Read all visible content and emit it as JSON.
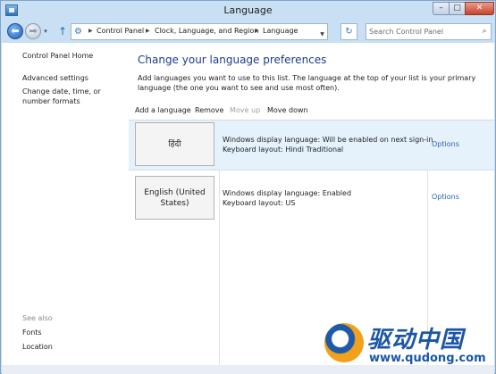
{
  "window": {
    "title": "Language",
    "controls": {
      "minimize": "–",
      "maximize": "□",
      "close": "✕"
    }
  },
  "nav": {
    "back": "⬅",
    "forward": "➡",
    "history": "▾",
    "up": "↑",
    "address": [
      "Control Panel",
      "Clock, Language, and Region",
      "Language"
    ],
    "refresh": "↻",
    "search_placeholder": "Search Control Panel"
  },
  "left_pane": {
    "home": "Control Panel Home",
    "links": [
      "Advanced settings",
      "Change date, time, or number formats"
    ],
    "see_also_heading": "See also",
    "see_also": [
      "Fonts",
      "Location"
    ]
  },
  "main": {
    "title": "Change your language preferences",
    "description": "Add languages you want to use to this list. The language at the top of your list is your primary language (the one you want to see and use most often).",
    "toolbar": {
      "add": "Add a language",
      "remove": "Remove",
      "move_up": "Move up",
      "move_down": "Move down"
    },
    "languages": [
      {
        "name": "हिंदी",
        "display": "Windows display language: Will be enabled on next sign-in",
        "keyboard": "Keyboard layout: Hindi Traditional",
        "options": "Options",
        "selected": true
      },
      {
        "name": "English (United States)",
        "display": "Windows display language: Enabled",
        "keyboard": "Keyboard layout: US",
        "options": "Options",
        "selected": false
      }
    ]
  },
  "watermark": {
    "name": "驱动中国",
    "url": "www.qudong.com"
  },
  "colors": {
    "frame": "#c9dff3",
    "accent_link": "#2b62b8",
    "heading": "#1e3c8c",
    "selected_row": "#e5f1fb",
    "watermark": "#1b56a6"
  }
}
